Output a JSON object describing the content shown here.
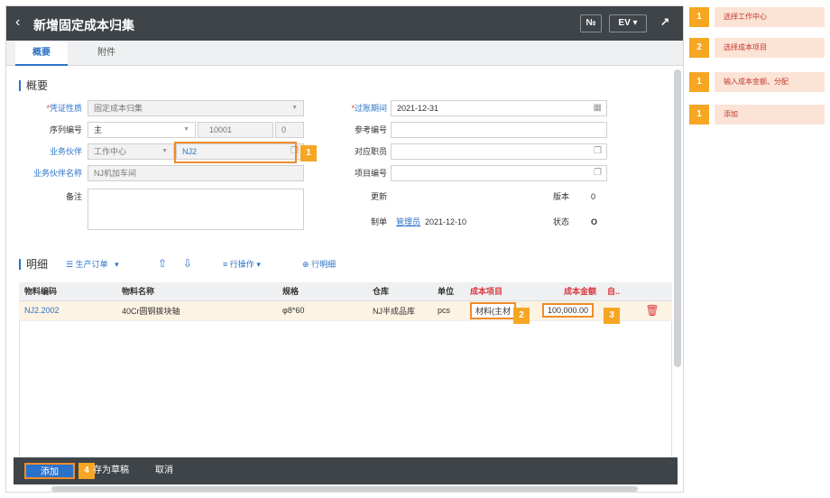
{
  "header": {
    "title": "新增固定成本归集",
    "no_label": "№",
    "ev_label": "EV ▾"
  },
  "tabs": [
    {
      "label": "概要"
    },
    {
      "label": "附件"
    }
  ],
  "summary": {
    "section_title": "概要",
    "voucher_nature": {
      "label": "凭证性质",
      "value": "固定成本归集"
    },
    "posting_period": {
      "label": "过账期间",
      "value": "2021-12-31"
    },
    "sequence_no": {
      "label": "序列编号",
      "value_main": "主",
      "value_num": "10001",
      "value_tail": "0"
    },
    "reference_no": {
      "label": "参考编号",
      "value": ""
    },
    "partner": {
      "label": "业务伙伴",
      "type": "工作中心",
      "value": "NJ2"
    },
    "staff": {
      "label": "对应职员",
      "value": ""
    },
    "partner_name": {
      "label": "业务伙伴名称",
      "value": "NJ机加车间"
    },
    "project_no": {
      "label": "项目编号",
      "value": ""
    },
    "remark": {
      "label": "备注",
      "value": ""
    },
    "update": {
      "label": "更新"
    },
    "version": {
      "label": "版本",
      "value": "0"
    },
    "maker": {
      "label": "制单",
      "user": "管理员",
      "date": "2021-12-10"
    },
    "status": {
      "label": "状态",
      "value": "O"
    }
  },
  "detail": {
    "section_title": "明细",
    "toolbar": {
      "production_order": "生产订单",
      "row_ops": "行操作",
      "row_detail": "行明细"
    },
    "columns": [
      "物料编码",
      "物料名称",
      "规格",
      "仓库",
      "单位",
      "成本项目",
      "成本金额",
      "自.."
    ],
    "rows": [
      {
        "code": "NJ2.2002",
        "name": "40Cr圆钢拨块轴",
        "spec": "φ8*60",
        "warehouse": "NJ半成品库",
        "unit": "pcs",
        "cost_item": "材料(主材",
        "amount": "100,000.00"
      }
    ]
  },
  "footer": {
    "add": "添加",
    "save_draft": "存为草稿",
    "cancel": "取消"
  },
  "callouts": [
    {
      "num": "1",
      "text": "选择工作中心"
    },
    {
      "num": "2",
      "text": "选择成本项目"
    },
    {
      "num": "1",
      "text": "输入成本金额、分配"
    },
    {
      "num": "1",
      "text": "添加"
    }
  ],
  "markers": {
    "m1": "1",
    "m2": "2",
    "m3": "3",
    "m4": "4"
  },
  "colors": {
    "accent": "#2a72c9",
    "highlight": "#f08c2a",
    "badge": "#f6a623",
    "header_bg": "#3f4449"
  }
}
